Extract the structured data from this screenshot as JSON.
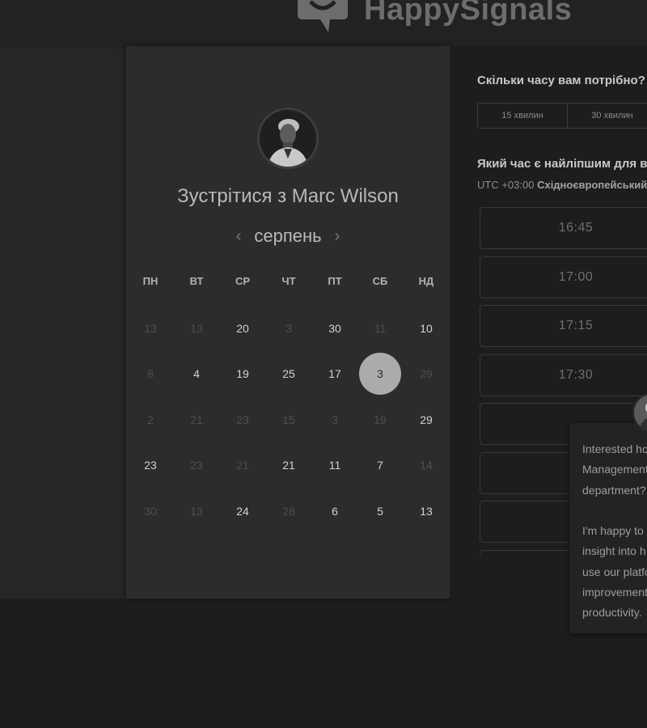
{
  "header": {
    "brand": "HappySignals"
  },
  "calendar": {
    "title": "Зустрітися з Marc Wilson",
    "month": "серпень",
    "weekdays": [
      "ПН",
      "ВТ",
      "СР",
      "ЧТ",
      "ПТ",
      "СБ",
      "НД"
    ],
    "weeks": [
      [
        {
          "label": "13",
          "enabled": false
        },
        {
          "label": "13",
          "enabled": false
        },
        {
          "label": "20",
          "enabled": true
        },
        {
          "label": "3",
          "enabled": false
        },
        {
          "label": "30",
          "enabled": true
        },
        {
          "label": "11",
          "enabled": false
        },
        {
          "label": "10",
          "enabled": true
        }
      ],
      [
        {
          "label": "8",
          "enabled": false
        },
        {
          "label": "4",
          "enabled": true
        },
        {
          "label": "19",
          "enabled": true
        },
        {
          "label": "25",
          "enabled": true
        },
        {
          "label": "17",
          "enabled": true
        },
        {
          "label": "3",
          "enabled": true,
          "selected": true
        },
        {
          "label": "29",
          "enabled": false
        }
      ],
      [
        {
          "label": "2",
          "enabled": false
        },
        {
          "label": "21",
          "enabled": false
        },
        {
          "label": "23",
          "enabled": false
        },
        {
          "label": "15",
          "enabled": false
        },
        {
          "label": "3",
          "enabled": false
        },
        {
          "label": "19",
          "enabled": false
        },
        {
          "label": "29",
          "enabled": true
        }
      ],
      [
        {
          "label": "23",
          "enabled": true
        },
        {
          "label": "23",
          "enabled": false
        },
        {
          "label": "21",
          "enabled": false
        },
        {
          "label": "21",
          "enabled": true
        },
        {
          "label": "11",
          "enabled": true
        },
        {
          "label": "7",
          "enabled": true
        },
        {
          "label": "14",
          "enabled": false
        }
      ],
      [
        {
          "label": "30",
          "enabled": false
        },
        {
          "label": "13",
          "enabled": false
        },
        {
          "label": "24",
          "enabled": true
        },
        {
          "label": "28",
          "enabled": false
        },
        {
          "label": "6",
          "enabled": true
        },
        {
          "label": "5",
          "enabled": true
        },
        {
          "label": "13",
          "enabled": true
        }
      ]
    ]
  },
  "booking": {
    "duration_question": "Скільки часу вам потрібно?",
    "durations": [
      "15 хвилин",
      "30 хвилин"
    ],
    "time_question": "Який час є найліпшим для вас?",
    "timezone_offset": "UTC +03:00",
    "timezone_name": "Східноєвропейський час",
    "slots": [
      "16:45",
      "17:00",
      "17:15",
      "17:30",
      "",
      "",
      "",
      ""
    ]
  },
  "chat": {
    "message": "Interested how\nManagement\ndepartment?\n\nI'm happy to\ninsight into h\nuse our platfo\nimprovement\nproductivity."
  },
  "colors": {
    "selected_day": "#ababab",
    "background": "#1d1d1d",
    "card": "#2c2c2c"
  }
}
